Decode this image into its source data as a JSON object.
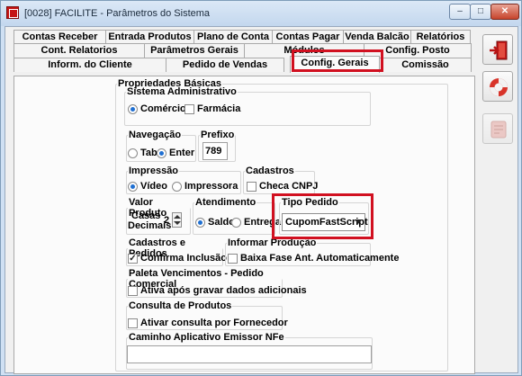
{
  "window": {
    "title": "[0028] FACILITE - Parâmetros do Sistema",
    "min_symbol": "–",
    "max_symbol": "□",
    "close_symbol": "✕"
  },
  "tabs": {
    "row1": [
      "Contas Receber",
      "Entrada Produtos",
      "Plano de Conta",
      "Contas Pagar",
      "Venda Balcão",
      "Relatórios"
    ],
    "row2": [
      "Cont. Relatorios",
      "Parâmetros Gerais",
      "Módulos",
      "Config. Posto"
    ],
    "row3": [
      "Inform. do Cliente",
      "Pedido de Vendas",
      "Config. Gerais",
      "Comissão"
    ],
    "active": "Config. Gerais"
  },
  "panel": {
    "basic_props": "Propriedades Básicas",
    "sistema_adm": {
      "label": "Sistema Administrativo",
      "opt_comercio": "Comércio",
      "opt_farmacia": "Farmácia",
      "selected": "Comércio"
    },
    "navegacao": {
      "label": "Navegação",
      "opt_tab": "Tab",
      "opt_enter": "Enter",
      "selected": "Enter"
    },
    "prefixo": {
      "label": "Prefixo",
      "value": "789"
    },
    "impressao": {
      "label": "Impressão",
      "opt_video": "Vídeo",
      "opt_impressora": "Impressora",
      "selected": "Vídeo"
    },
    "cadastros": {
      "label": "Cadastros",
      "checa_cnpj": "Checa CNPJ",
      "checked": false
    },
    "valor_produto": {
      "label": "Valor Produto",
      "casas": "Casas",
      "decimais": "Decimais",
      "value": "2"
    },
    "atendimento": {
      "label": "Atendimento",
      "opt_saldo": "Saldo",
      "opt_entrega": "Entrega",
      "selected": "Saldo"
    },
    "tipo_pedido": {
      "label": "Tipo Pedido",
      "value": "CupomFastScript"
    },
    "cad_pedidos": {
      "label": "Cadastros e Pedidos",
      "confirma": "Confirma Inclusão",
      "checked": true
    },
    "informar_producao": {
      "label": "Informar Produção",
      "baixa": "Baixa Fase Ant. Automaticamente",
      "checked": false
    },
    "paleta": {
      "label": "Paleta Vencimentos - Pedido Comercial",
      "ativa": "Ativa após gravar dados adicionais",
      "checked": false
    },
    "consulta": {
      "label": "Consulta de Produtos",
      "ativar": "Ativar consulta por Fornecedor",
      "checked": false
    },
    "caminho": {
      "label": "Caminho Aplicativo Emissor NFe",
      "value": ""
    }
  },
  "side_buttons": [
    "exit-door-icon",
    "lifebuoy-help-icon",
    "disabled-action-icon"
  ],
  "colors": {
    "highlight": "#d11020",
    "selection": "#1f6fd1"
  }
}
